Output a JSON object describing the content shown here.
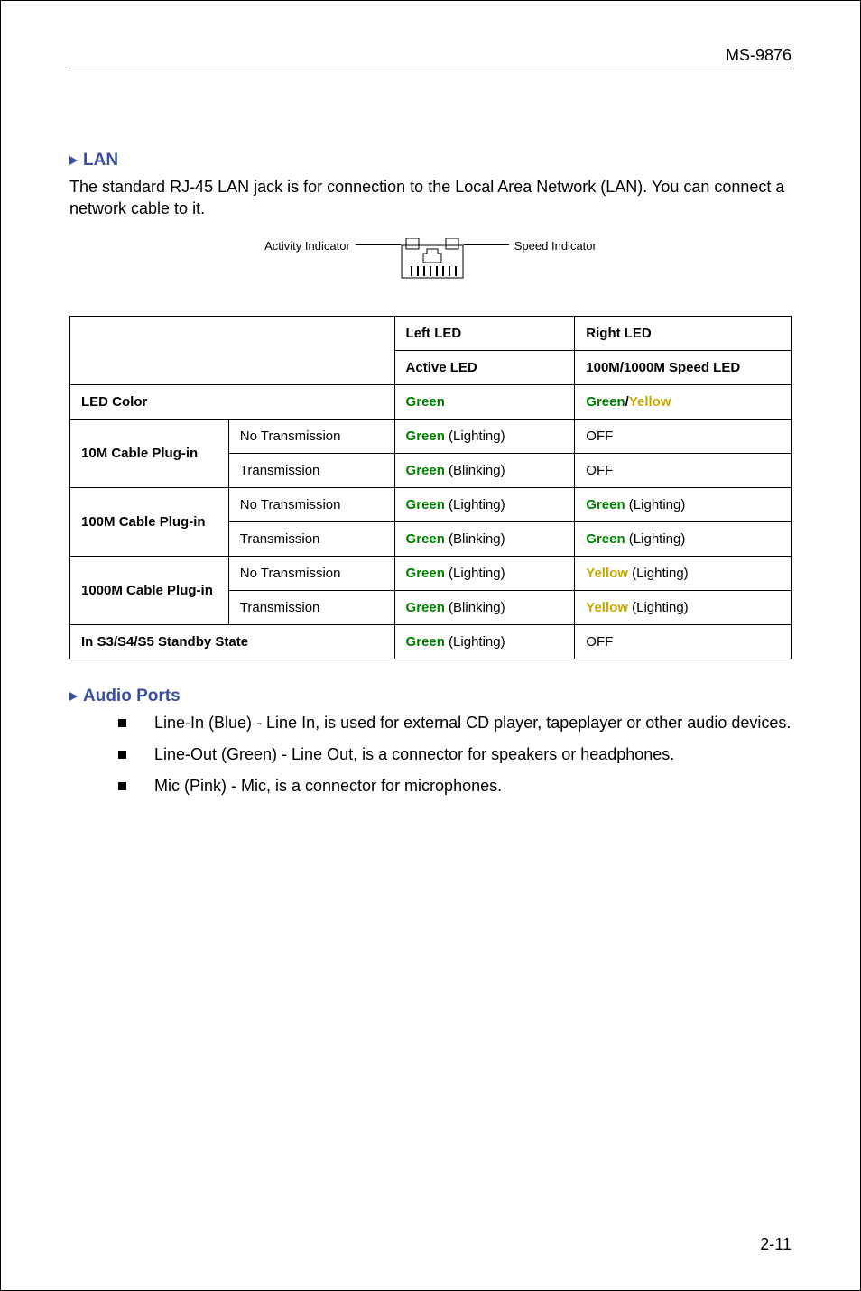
{
  "header": {
    "doc_id": "MS-9876"
  },
  "lan": {
    "heading": "LAN",
    "para": "The standard RJ-45 LAN jack is for connection to the Local Area Network (LAN). You can connect a network cable to it.",
    "figure": {
      "activity_label": "Activity Indicator",
      "speed_label": "Speed Indicator"
    },
    "table": {
      "hdr_left": "Left LED",
      "hdr_right": "Right LED",
      "hdr_active": "Active LED",
      "hdr_speed": "100M/1000M Speed LED",
      "row_ledcolor_label": "LED Color",
      "row_ledcolor_left": "Green",
      "row_ledcolor_right_g": "Green",
      "row_ledcolor_right_slash": "/",
      "row_ledcolor_right_y": "Yellow",
      "r10_label": "10M Cable Plug-in",
      "no_tx": "No Transmission",
      "tx": "Transmission",
      "g_light": "Green",
      "g_light_sfx": " (Lighting)",
      "g_blink": "Green",
      "g_blink_sfx": " (Blinking)",
      "off": "OFF",
      "r100_label": "100M Cable Plug-in",
      "r1000_label": "1000M Cable Plug-in",
      "y_light": "Yellow",
      "y_light_sfx": " (Lighting)",
      "standby_label": "In S3/S4/S5 Standby State"
    }
  },
  "audio": {
    "heading": "Audio Ports",
    "items": [
      "Line-In (Blue) - Line In, is used for external CD player, tapeplayer or other audio devices.",
      "Line-Out (Green) - Line Out, is a connector for speakers or headphones.",
      "Mic (Pink) - Mic, is a connector for microphones."
    ]
  },
  "footer": {
    "page_num": "2-11"
  }
}
